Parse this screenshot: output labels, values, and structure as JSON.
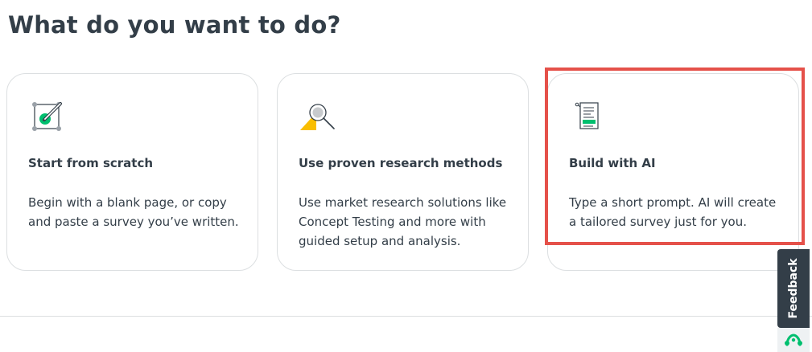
{
  "heading": "What do you want to do?",
  "cards": [
    {
      "title": "Start from scratch",
      "description": "Begin with a blank page, or copy and paste a survey you’ve written.",
      "icon": "blank-page-pencil-icon"
    },
    {
      "title": "Use proven research methods",
      "description": "Use market research solutions like Concept Testing and more with guided setup and analysis.",
      "icon": "magnifier-research-icon"
    },
    {
      "title": "Build with AI",
      "description": "Type a short prompt. AI will create a tailored survey just for you.",
      "icon": "ai-document-icon"
    }
  ],
  "feedback": {
    "label": "Feedback",
    "icon": "surveymonkey-logo-icon"
  },
  "colors": {
    "text": "#333e48",
    "card_border": "#dcdfe1",
    "highlight": "#e5514a",
    "green": "#00bf6f",
    "yellow": "#f9be00",
    "feedback_bg": "#333e48"
  }
}
